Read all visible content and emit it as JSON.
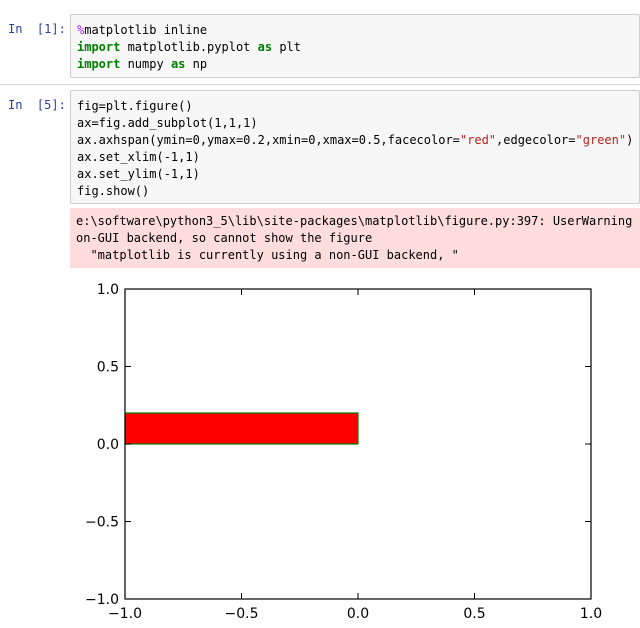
{
  "cells": [
    {
      "prompt": "In  [1]:",
      "lines": [
        [
          {
            "t": "%",
            "c": "magic"
          },
          {
            "t": "matplotlib inline",
            "c": ""
          }
        ],
        [
          {
            "t": "import",
            "c": "kw"
          },
          {
            "t": " matplotlib.pyplot ",
            "c": ""
          },
          {
            "t": "as",
            "c": "kw"
          },
          {
            "t": " plt",
            "c": ""
          }
        ],
        [
          {
            "t": "import",
            "c": "kw"
          },
          {
            "t": " numpy ",
            "c": ""
          },
          {
            "t": "as",
            "c": "kw"
          },
          {
            "t": " np",
            "c": ""
          }
        ]
      ]
    },
    {
      "prompt": "In  [5]:",
      "lines": [
        [
          {
            "t": "fig=plt.figure()",
            "c": ""
          }
        ],
        [
          {
            "t": "ax=fig.add_subplot(1,1,1)",
            "c": ""
          }
        ],
        [
          {
            "t": "ax.axhspan(ymin=0,ymax=0.2,xmin=0,xmax=0.5,facecolor=",
            "c": ""
          },
          {
            "t": "\"red\"",
            "c": "str"
          },
          {
            "t": ",edgecolor=",
            "c": ""
          },
          {
            "t": "\"green\"",
            "c": "str"
          },
          {
            "t": ")",
            "c": ""
          }
        ],
        [
          {
            "t": "ax.set_xlim(-1,1)",
            "c": ""
          }
        ],
        [
          {
            "t": "ax.set_ylim(-1,1)",
            "c": ""
          }
        ],
        [
          {
            "t": "fig.show()",
            "c": ""
          }
        ]
      ]
    }
  ],
  "stderr": {
    "lines": [
      "e:\\software\\python3_5\\lib\\site-packages\\matplotlib\\figure.py:397: UserWarning: ma",
      "on-GUI backend, so cannot show the figure",
      "  \"matplotlib is currently using a non-GUI backend, \""
    ]
  },
  "colors": {
    "prompt": "#303f9f",
    "stderr_bg": "#ffdddd",
    "span_face": "#ff0000",
    "span_edge": "#008000"
  },
  "chart_data": {
    "type": "area",
    "xlim": [
      -1,
      1
    ],
    "ylim": [
      -1,
      1
    ],
    "xticks": [
      -1.0,
      -0.5,
      0.0,
      0.5,
      1.0
    ],
    "xtick_labels": [
      "−1.0",
      "−0.5",
      "0.0",
      "0.5",
      "1.0"
    ],
    "yticks": [
      -1.0,
      -0.5,
      0.0,
      0.5,
      1.0
    ],
    "ytick_labels": [
      "−1.0",
      "−0.5",
      "0.0",
      "0.5",
      "1.0"
    ],
    "spans": [
      {
        "ymin": 0,
        "ymax": 0.2,
        "xmin_frac": 0,
        "xmax_frac": 0.5,
        "facecolor": "#ff0000",
        "edgecolor": "#008000"
      }
    ],
    "grid": false
  }
}
